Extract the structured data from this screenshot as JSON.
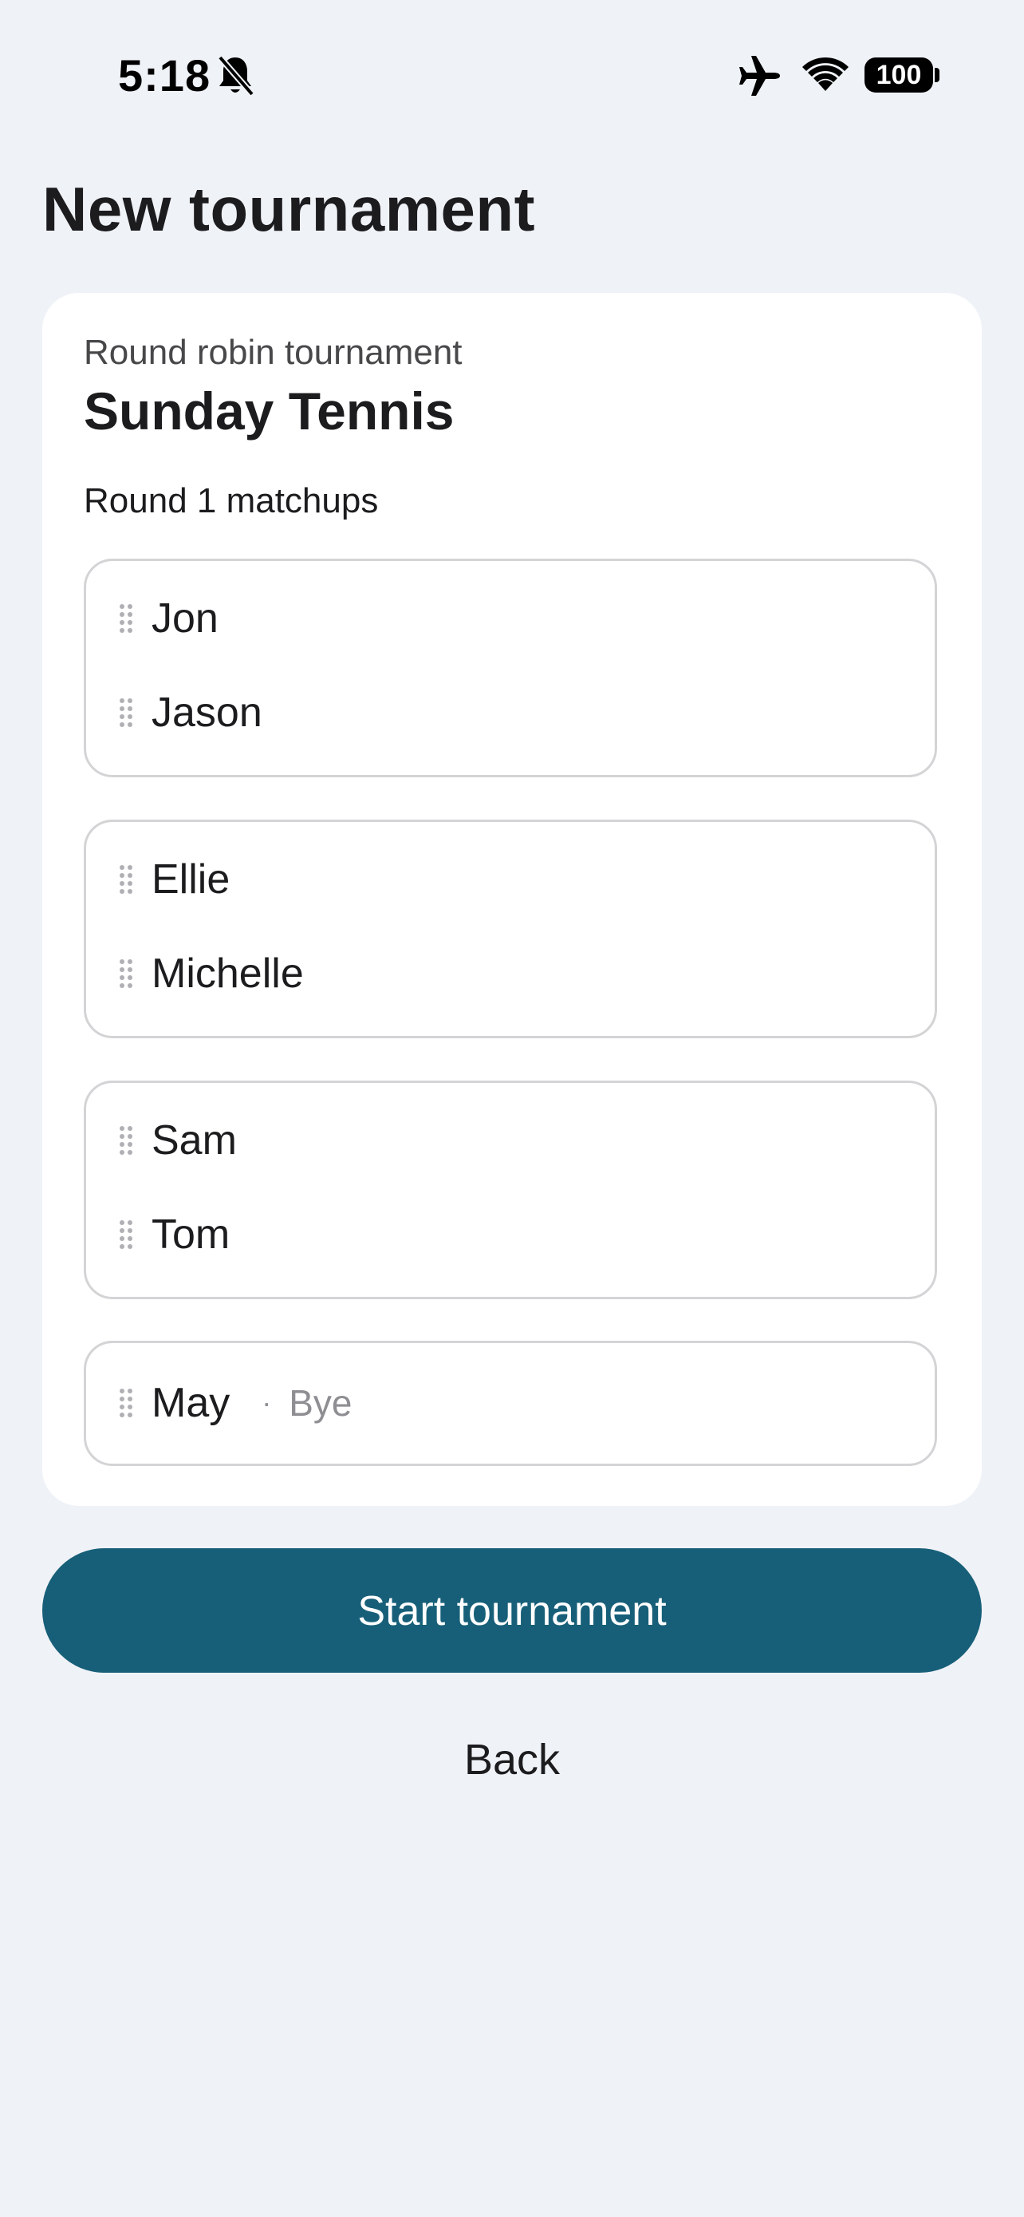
{
  "status_bar": {
    "time": "5:18",
    "battery": "100",
    "icons": [
      "bell-muted-icon",
      "airplane-icon",
      "wifi-icon",
      "battery-icon"
    ]
  },
  "page": {
    "title": "New tournament"
  },
  "card": {
    "subtitle": "Round robin tournament",
    "title": "Sunday Tennis",
    "section_label": "Round 1 matchups",
    "matches": [
      {
        "players": [
          "Jon",
          "Jason"
        ]
      },
      {
        "players": [
          "Ellie",
          "Michelle"
        ]
      },
      {
        "players": [
          "Sam",
          "Tom"
        ]
      },
      {
        "players": [
          "May"
        ],
        "bye_separator": "·",
        "bye_label": "Bye"
      }
    ]
  },
  "actions": {
    "start_label": "Start tournament",
    "back_label": "Back"
  },
  "colors": {
    "background": "#eff2f7",
    "card": "#ffffff",
    "accent": "#175f78",
    "border": "#d4d4d6",
    "muted_text": "#8e8e93"
  }
}
